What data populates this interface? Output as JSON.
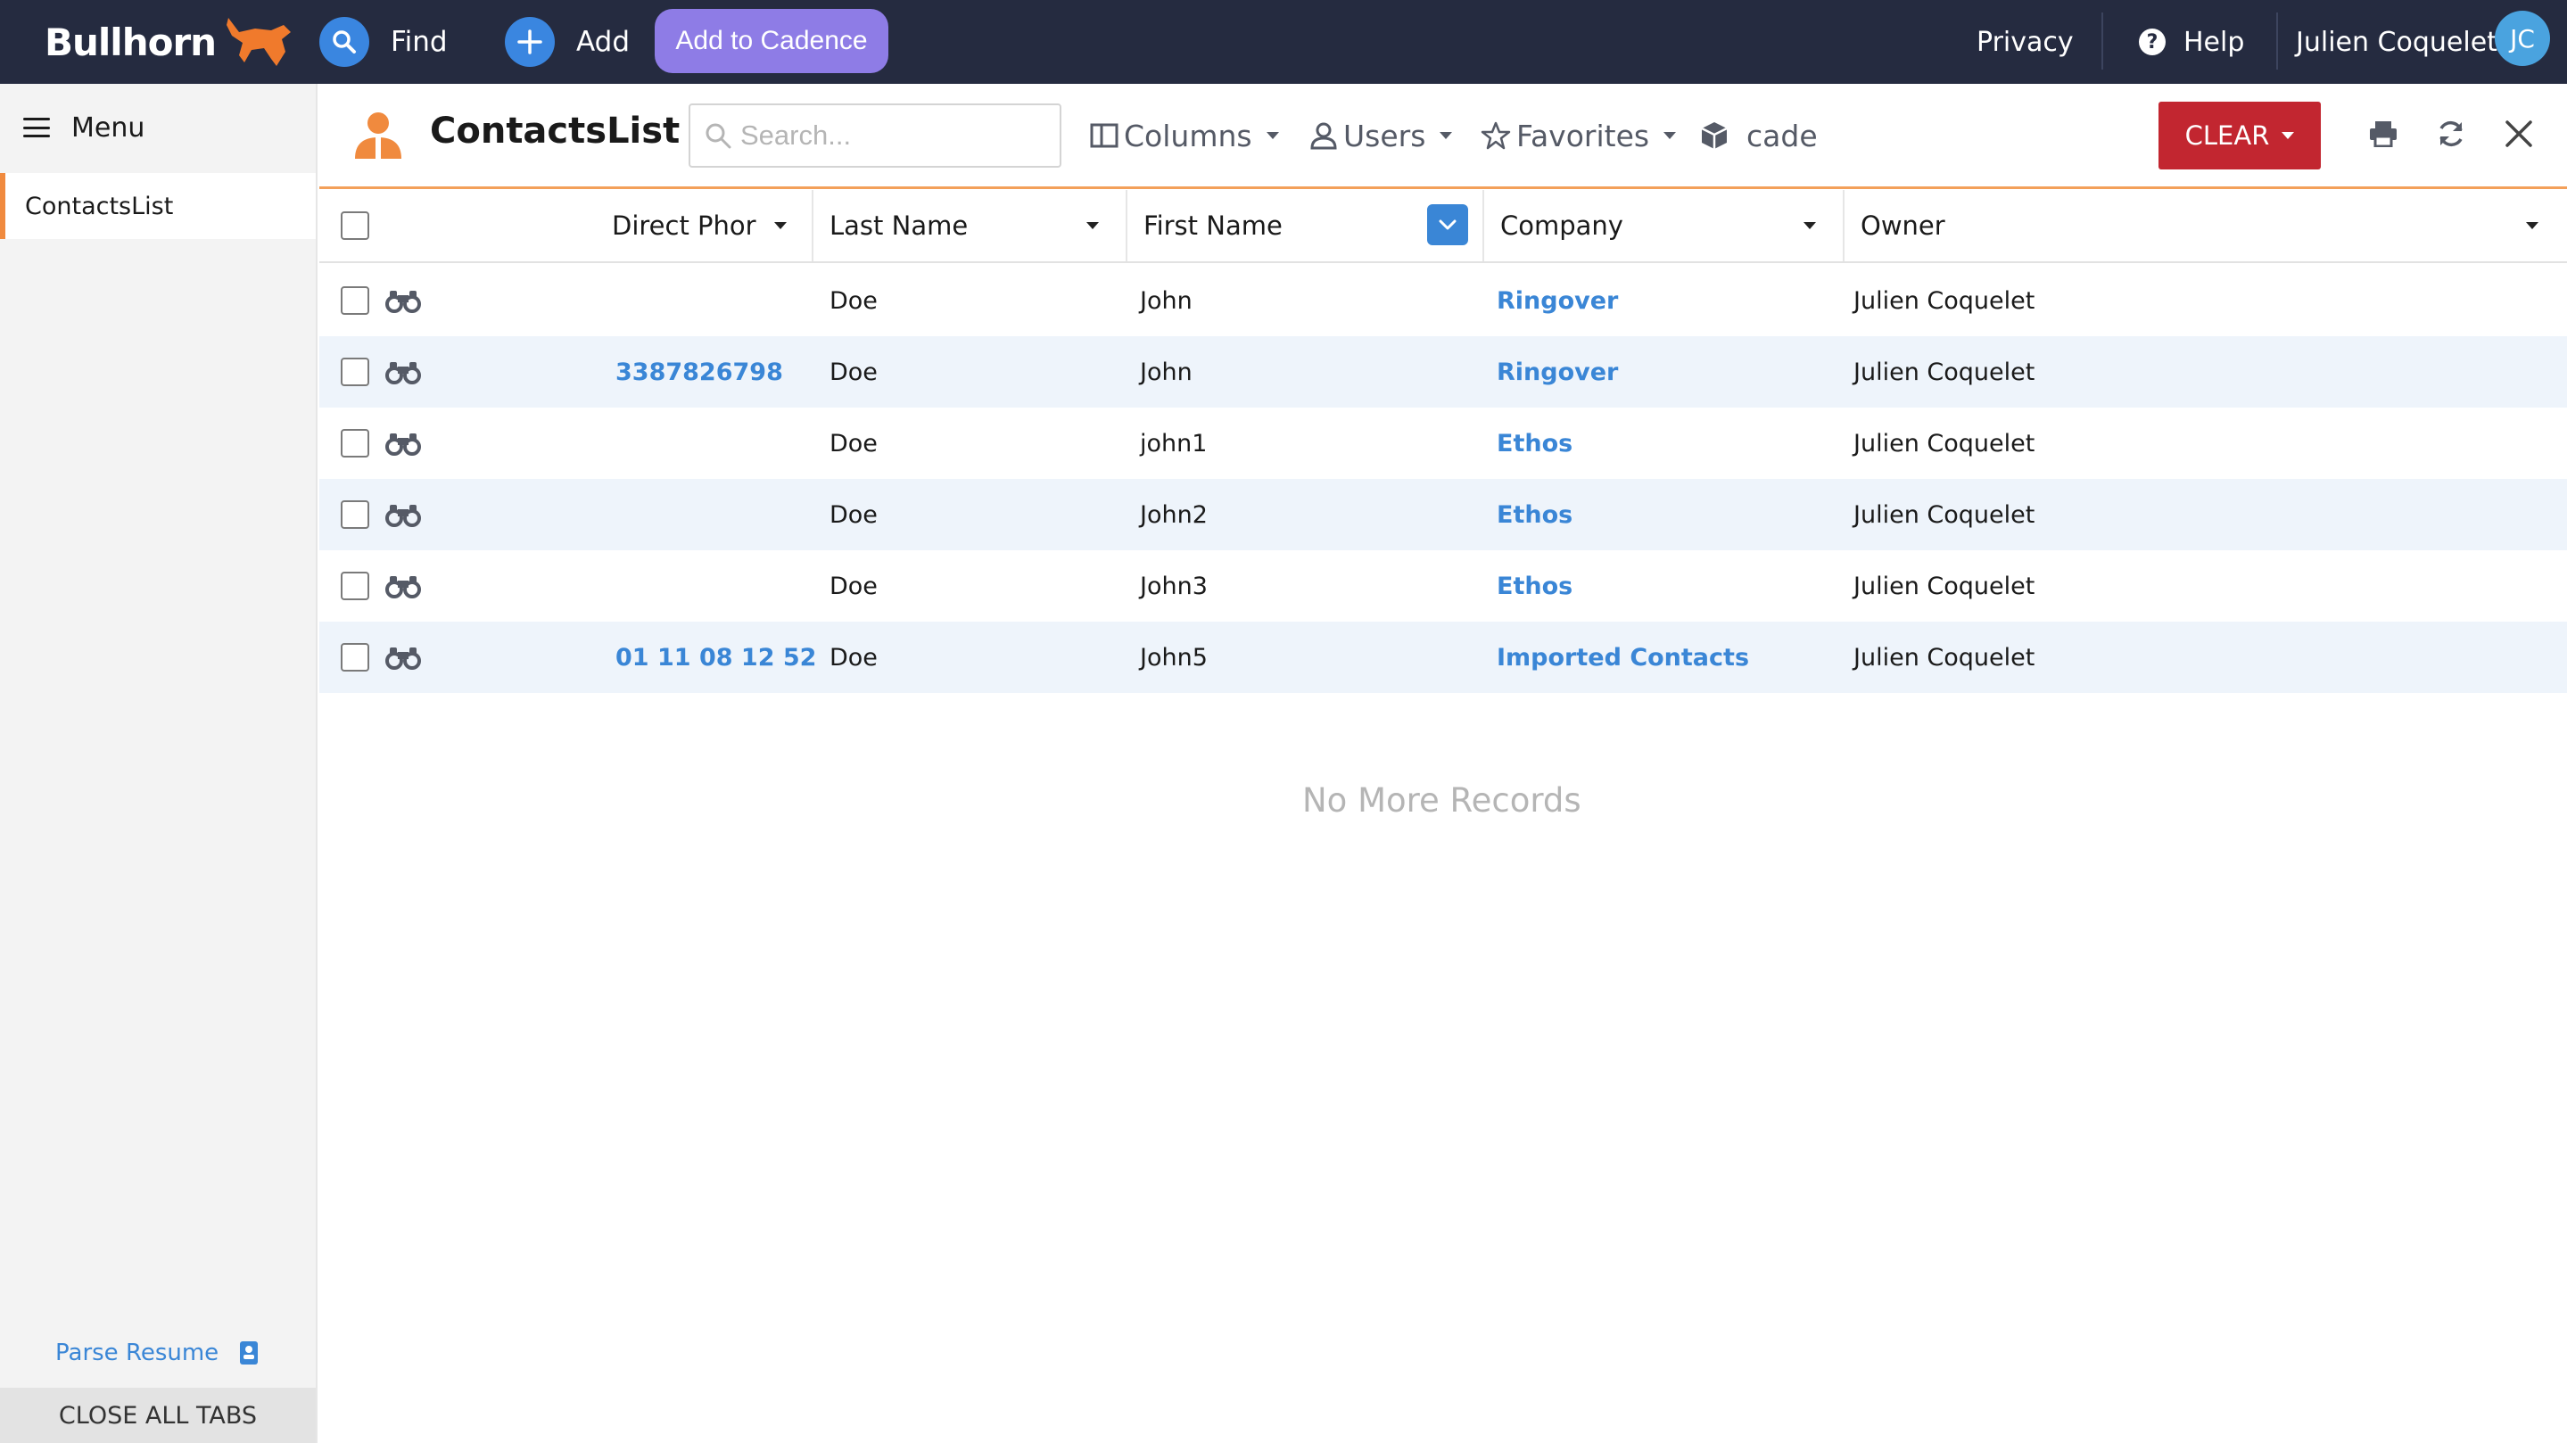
{
  "nav": {
    "brand": "Bullhorn",
    "find_label": "Find",
    "add_label": "Add",
    "cadence_label": "Add to Cadence",
    "privacy_label": "Privacy",
    "help_label": "Help",
    "user_name": "Julien Coquelet",
    "user_initials": "JC",
    "colors": {
      "bar": "#252b40",
      "circle": "#3a86e0",
      "cadence": "#8e7ce6",
      "avatar": "#4aa3df"
    }
  },
  "sidebar": {
    "menu_label": "Menu",
    "tabs": [
      {
        "label": "ContactsList",
        "active": true
      }
    ],
    "parse_resume_label": "Parse Resume",
    "close_all_label": "CLOSE ALL TABS"
  },
  "toolbar": {
    "title": "ContactsList",
    "search_placeholder": "Search...",
    "columns_label": "Columns",
    "users_label": "Users",
    "favorites_label": "Favorites",
    "cade_label": "cade",
    "clear_label": "CLEAR",
    "icons": [
      "print-icon",
      "refresh-icon",
      "close-icon"
    ]
  },
  "table": {
    "columns": [
      "Direct Phor",
      "Last Name",
      "First Name",
      "Company",
      "Owner"
    ],
    "rows": [
      {
        "phone": "",
        "last": "Doe",
        "first": "John",
        "company": "Ringover",
        "owner": "Julien Coquelet"
      },
      {
        "phone": "3387826798",
        "last": "Doe",
        "first": "John",
        "company": "Ringover",
        "owner": "Julien Coquelet"
      },
      {
        "phone": "",
        "last": "Doe",
        "first": "john1",
        "company": "Ethos",
        "owner": "Julien Coquelet"
      },
      {
        "phone": "",
        "last": "Doe",
        "first": "John2",
        "company": "Ethos",
        "owner": "Julien Coquelet"
      },
      {
        "phone": "",
        "last": "Doe",
        "first": "John3",
        "company": "Ethos",
        "owner": "Julien Coquelet"
      },
      {
        "phone": "01 11 08 12 52",
        "last": "Doe",
        "first": "John5",
        "company": "Imported Contacts",
        "owner": "Julien Coquelet"
      }
    ],
    "footer": "No More Records",
    "colors": {
      "link": "#3a86d6",
      "alt_row": "#eef4fb"
    }
  }
}
